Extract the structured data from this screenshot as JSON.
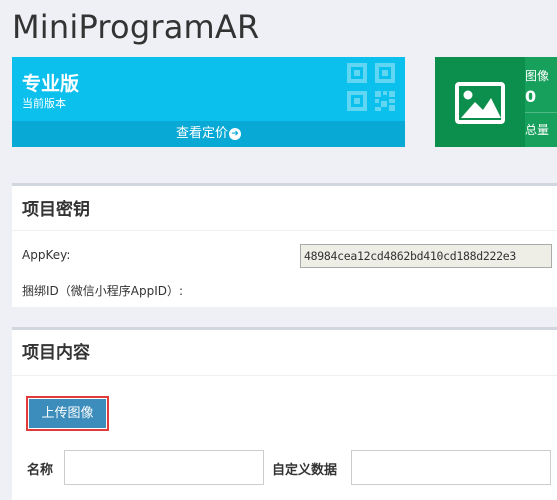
{
  "app": {
    "title": "MiniProgramAR"
  },
  "plan_card": {
    "name": "专业版",
    "subtitle": "当前版本",
    "link_label": "查看定价",
    "icon": "qr-code-icon",
    "color": "#0cc0ee"
  },
  "stats_card": {
    "icon": "image-icon",
    "label": "图像",
    "value": "0",
    "label2": "总量",
    "color": "#0c8f4d"
  },
  "key_panel": {
    "title": "项目密钥",
    "appkey_label": "AppKey:",
    "appkey_value": "48984cea12cd4862bd410cd188d222e3",
    "bind_label": "捆绑ID（微信小程序AppID）:"
  },
  "content_panel": {
    "title": "项目内容",
    "upload_button": "上传图像",
    "name_label": "名称",
    "custom_label": "自定义数据",
    "name_value": "",
    "custom_value": ""
  }
}
